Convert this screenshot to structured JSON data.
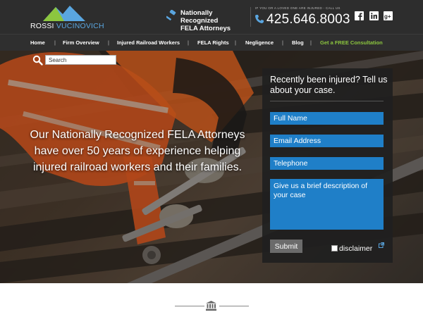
{
  "brand": {
    "logo_part1": "ROSSI",
    "logo_part2": "VUCINOVICH",
    "logo_icon": "mountains-logo",
    "accent_green": "#8cc63f",
    "accent_blue": "#1f7fc8"
  },
  "header": {
    "tagline_line1": "Nationally Recognized",
    "tagline_line2": "FELA Attorneys",
    "call_prompt": "IF YOU OR A LOVED ONE ARE INJURED - CALL US",
    "phone": "425.646.8003",
    "social": [
      "facebook-icon",
      "linkedin-icon",
      "googleplus-icon"
    ]
  },
  "nav": {
    "items": [
      {
        "label": "Home"
      },
      {
        "label": "Firm Overview"
      },
      {
        "label": "Injured Railroad Workers"
      },
      {
        "label": "FELA Rights"
      },
      {
        "label": "Negligence"
      },
      {
        "label": "Blog"
      },
      {
        "label": "Get a FREE Consultation"
      }
    ]
  },
  "search": {
    "placeholder": "Search"
  },
  "hero": {
    "headline": "Our Nationally Recognized FELA Attorneys have over 50 years of experience helping injured railroad workers and their families."
  },
  "form": {
    "title": "Recently been injured? Tell us about your case.",
    "name_placeholder": "Full Name",
    "email_placeholder": "Email Address",
    "phone_placeholder": "Telephone",
    "desc_placeholder": "Give us a brief description of your case",
    "submit_label": "Submit",
    "disclaimer_label": "disclaimer"
  },
  "footer": {
    "icon": "bank-icon"
  }
}
